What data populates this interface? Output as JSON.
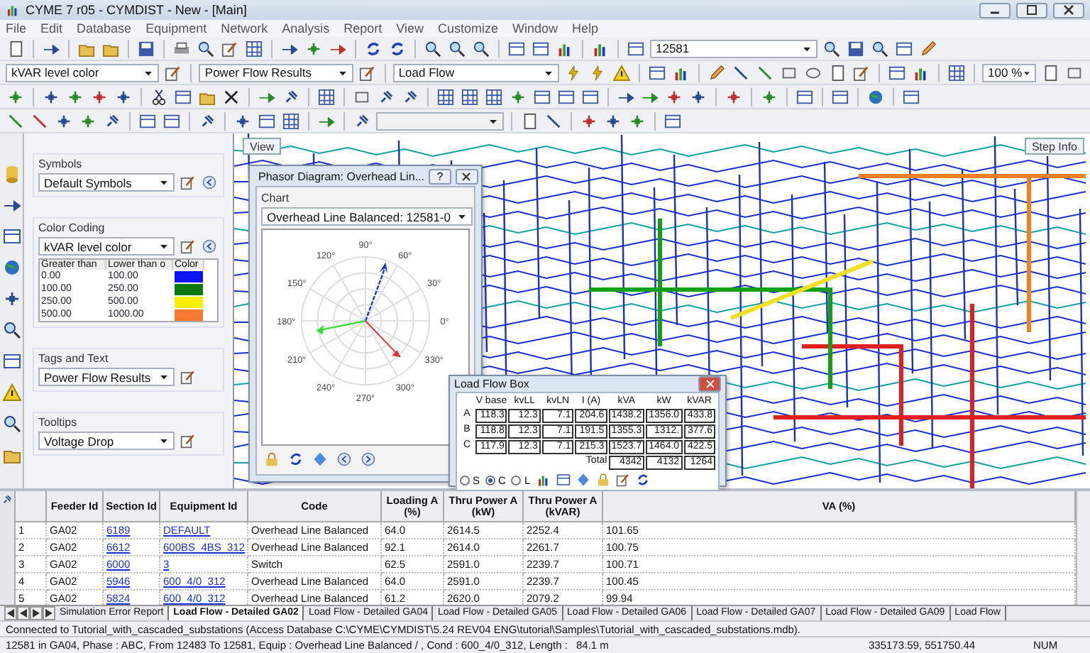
{
  "window": {
    "title": "CYME 7 r05  - CYMDIST - New - [Main]"
  },
  "menu": [
    "File",
    "Edit",
    "Database",
    "Equipment",
    "Network",
    "Analysis",
    "Report",
    "View",
    "Customize",
    "Window",
    "Help"
  ],
  "toolbar": {
    "layer_combo": "kVAR level color",
    "results_combo": "Power Flow Results",
    "study_combo": "Load Flow",
    "search_combo": "12581",
    "zoom_combo": "100 %"
  },
  "side_panel": {
    "symbols": {
      "label": "Symbols",
      "value": "Default Symbols"
    },
    "color_coding": {
      "label": "Color Coding",
      "value": "kVAR level color",
      "columns": [
        "Greater than",
        "Lower than o",
        "Color"
      ],
      "rows": [
        {
          "greater": "0.00",
          "lower": "100.00",
          "color": "#0a14f0"
        },
        {
          "greater": "100.00",
          "lower": "250.00",
          "color": "#0a7a10"
        },
        {
          "greater": "250.00",
          "lower": "500.00",
          "color": "#f5f000"
        },
        {
          "greater": "500.00",
          "lower": "1000.00",
          "color": "#f57a30"
        }
      ]
    },
    "tags": {
      "label": "Tags and Text",
      "value": "Power Flow Results"
    },
    "tooltips": {
      "label": "Tooltips",
      "value": "Voltage Drop"
    }
  },
  "map": {
    "view_button": "View",
    "step_button": "Step Info"
  },
  "phasor_dialog": {
    "title": "Phasor Diagram: Overhead Lin...",
    "help": "?",
    "chart_label": "Chart",
    "chart_combo": "Overhead Line Balanced: 12581-0",
    "angle_labels": [
      "0°",
      "30°",
      "60°",
      "90°",
      "120°",
      "150°",
      "180°",
      "210°",
      "240°",
      "270°",
      "300°",
      "330°"
    ]
  },
  "load_flow_box": {
    "title": "Load Flow Box",
    "columns": [
      "V base",
      "kvLL",
      "kvLN",
      "I (A)",
      "kVA",
      "kW",
      "kVAR"
    ],
    "rows": [
      {
        "phase": "A",
        "values": [
          "118.3",
          "12.3",
          "7.1",
          "204.6",
          "1438.2",
          "1356.0",
          "433.8"
        ]
      },
      {
        "phase": "B",
        "values": [
          "118.8",
          "12.3",
          "7.1",
          "191.5",
          "1355.3",
          "1312.",
          "377.6"
        ]
      },
      {
        "phase": "C",
        "values": [
          "117.9",
          "12.3",
          "7.1",
          "215.3",
          "1523.7",
          "1464.0",
          "422.5"
        ]
      }
    ],
    "total_label": "Total",
    "totals": [
      "4342",
      "4132",
      "1264"
    ],
    "modes": [
      {
        "label": "S",
        "selected": false
      },
      {
        "label": "C",
        "selected": true
      },
      {
        "label": "L",
        "selected": false
      }
    ]
  },
  "table": {
    "columns": [
      "Feeder Id",
      "Section Id",
      "Equipment Id",
      "Code",
      "Loading A (%)",
      "Thru Power A (kW)",
      "Thru Power A (kVAR)",
      "VA (%)"
    ],
    "rows": [
      {
        "n": "1",
        "cells": [
          "GA02",
          "6189",
          "DEFAULT",
          "Overhead Line Balanced",
          "64.0",
          "2614.5",
          "2252.4",
          "101.65"
        ]
      },
      {
        "n": "2",
        "cells": [
          "GA02",
          "6612",
          "600BS_4BS_312",
          "Overhead Line Balanced",
          "92.1",
          "2614.0",
          "2261.7",
          "100.75"
        ]
      },
      {
        "n": "3",
        "cells": [
          "GA02",
          "6000",
          "3",
          "Switch",
          "62.5",
          "2591.0",
          "2239.7",
          "100.71"
        ]
      },
      {
        "n": "4",
        "cells": [
          "GA02",
          "5946",
          "600_4/0_312",
          "Overhead Line Balanced",
          "64.0",
          "2591.0",
          "2239.7",
          "100.45"
        ]
      },
      {
        "n": "5",
        "cells": [
          "GA02",
          "5824",
          "600_4/0_312",
          "Overhead Line Balanced",
          "61.2",
          "2620.0",
          "2079.2",
          "99.94"
        ]
      }
    ]
  },
  "report_tabs": [
    {
      "label": "Simulation Error Report",
      "selected": false
    },
    {
      "label": "Load Flow - Detailed GA02",
      "selected": true
    },
    {
      "label": "Load Flow - Detailed GA04",
      "selected": false
    },
    {
      "label": "Load Flow - Detailed GA05",
      "selected": false
    },
    {
      "label": "Load Flow - Detailed GA06",
      "selected": false
    },
    {
      "label": "Load Flow - Detailed GA07",
      "selected": false
    },
    {
      "label": "Load Flow - Detailed GA09",
      "selected": false
    },
    {
      "label": "Load Flow",
      "selected": false
    }
  ],
  "status_bar": {
    "message": "Connected to Tutorial_with_cascaded_substations (Access Database C:\\CYME\\CYMDIST\\5.24 REV04 ENG\\tutorial\\Samples\\Tutorial_with_cascaded_substations.mdb).",
    "selection": "12581 in GA04, Phase : ABC, From 12483 To 12581, Equip : Overhead Line Balanced / , Cond : 600_4/0_312, Length :",
    "length": "84.1 m",
    "coordinates": "335173.59, 551750.44",
    "mode": "NUM"
  }
}
